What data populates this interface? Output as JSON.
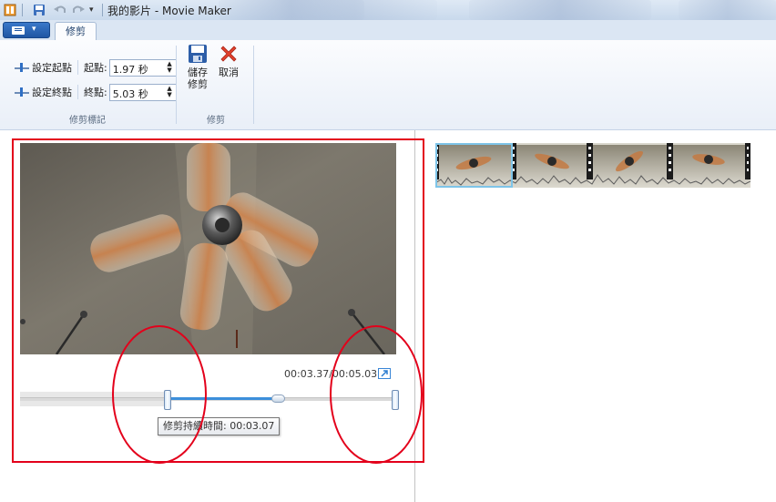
{
  "window": {
    "title": "我的影片 - Movie Maker",
    "quick_access_dropdown": "▾"
  },
  "tabs": {
    "app_menu_caret": "▾",
    "active_tab": "修剪"
  },
  "ribbon": {
    "trim_markers": {
      "set_start_label": "設定起點",
      "set_end_label": "設定終點",
      "start_point_label": "起點:",
      "end_point_label": "終點:",
      "start_value": "1.97 秒",
      "end_value": "5.03 秒",
      "group_label": "修剪標記"
    },
    "trim": {
      "save_trim_label_1": "儲存",
      "save_trim_label_2": "修剪",
      "cancel_label": "取消",
      "group_label": "修剪"
    }
  },
  "preview": {
    "time_readout": "00:03.37/00:05.03",
    "tooltip": "修剪持續時間: 00:03.07",
    "trim_start_fraction": 0.39,
    "trim_end_fraction": 1.0,
    "playhead_fraction": 0.68
  },
  "colors": {
    "accent_blue": "#3c8fdb",
    "annotation_red": "#e3001b",
    "ribbon_bg": "#f4f7fc"
  }
}
